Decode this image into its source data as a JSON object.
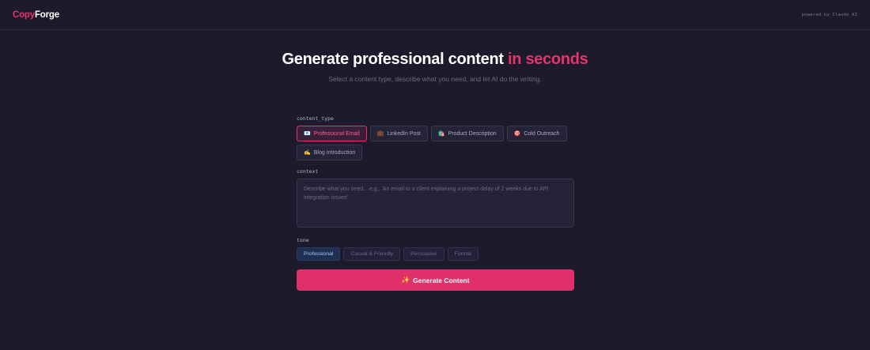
{
  "header": {
    "logo_part1": "Copy",
    "logo_part2": "Forge",
    "powered_by": "powered by Claude AI"
  },
  "hero": {
    "title_main": "Generate professional content",
    "title_accent": "in seconds",
    "subtitle": "Select a content type, describe what you need, and let AI do the writing."
  },
  "content_type": {
    "label": "content_type",
    "options": [
      {
        "icon": "📧",
        "label": "Professional Email",
        "selected": true
      },
      {
        "icon": "💼",
        "label": "LinkedIn Post",
        "selected": false
      },
      {
        "icon": "🛍️",
        "label": "Product Description",
        "selected": false
      },
      {
        "icon": "🎯",
        "label": "Cold Outreach",
        "selected": false
      },
      {
        "icon": "✍️",
        "label": "Blog Introduction",
        "selected": false
      }
    ]
  },
  "context": {
    "label": "context",
    "placeholder": "Describe what you need... e.g., 'An email to a client explaining a project delay of 2 weeks due to API integration issues'",
    "value": ""
  },
  "tone": {
    "label": "tone",
    "options": [
      {
        "label": "Professional",
        "selected": true
      },
      {
        "label": "Casual & Friendly",
        "selected": false
      },
      {
        "label": "Persuasive",
        "selected": false
      },
      {
        "label": "Formal",
        "selected": false
      }
    ]
  },
  "generate": {
    "icon": "✨",
    "label": "Generate Content"
  },
  "colors": {
    "background": "#1c1a2b",
    "accent": "#e8336a",
    "tone_selected": "#203052"
  }
}
